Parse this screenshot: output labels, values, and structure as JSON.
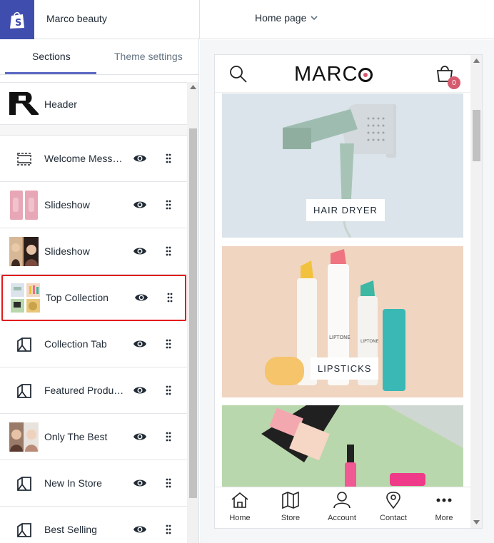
{
  "topbar": {
    "brand_icon": "shopify-bag-icon",
    "store_name": "Marco beauty",
    "page_select": "Home page",
    "accent": "#3f4eae"
  },
  "sidebar": {
    "tabs": [
      {
        "label": "Sections",
        "active": true
      },
      {
        "label": "Theme settings",
        "active": false
      }
    ],
    "header_item": {
      "label": "Header"
    },
    "sections": [
      {
        "label": "Welcome Message",
        "thumb": "dashed-box-icon",
        "visible": true
      },
      {
        "label": "Slideshow",
        "thumb": "pink-slides-thumb",
        "visible": true
      },
      {
        "label": "Slideshow",
        "thumb": "portrait-thumb",
        "visible": true
      },
      {
        "label": "Top Collection",
        "thumb": "collection-thumb",
        "visible": true,
        "selected": true
      },
      {
        "label": "Collection Tab",
        "thumb": "template-icon",
        "visible": true
      },
      {
        "label": "Featured Products",
        "thumb": "template-icon",
        "visible": true
      },
      {
        "label": "Only The Best",
        "thumb": "portrait-thumb",
        "visible": true
      },
      {
        "label": "New In Store",
        "thumb": "template-icon",
        "visible": true
      },
      {
        "label": "Best Selling",
        "thumb": "template-icon",
        "visible": true
      }
    ]
  },
  "preview": {
    "store_logo": "MARC",
    "cart_count": "0",
    "collections": [
      {
        "label": "HAIR DRYER"
      },
      {
        "label": "LIPSTICKS"
      }
    ],
    "product_text": "LIPTONE",
    "bottom_nav": [
      {
        "label": "Home",
        "icon": "home-icon"
      },
      {
        "label": "Store",
        "icon": "map-icon"
      },
      {
        "label": "Account",
        "icon": "user-icon"
      },
      {
        "label": "Contact",
        "icon": "pin-icon"
      },
      {
        "label": "More",
        "icon": "more-icon"
      }
    ]
  }
}
